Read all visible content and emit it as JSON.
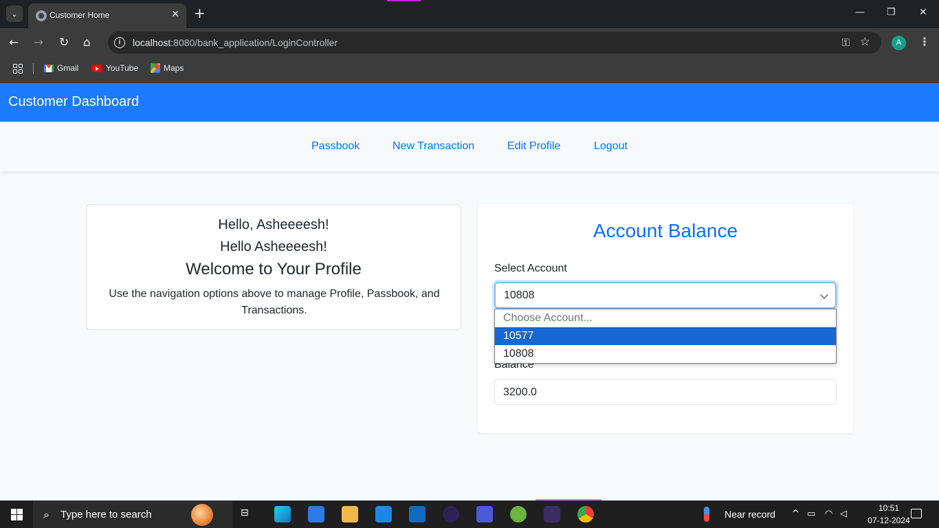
{
  "browser": {
    "tab_title": "Customer Home",
    "url_host": "localhost",
    "url_rest": ":8080/bank_application/LoginController",
    "profile_initial": "A",
    "bookmarks": [
      {
        "label": "Gmail",
        "icon": "gmail-icon"
      },
      {
        "label": "YouTube",
        "icon": "youtube-icon"
      },
      {
        "label": "Maps",
        "icon": "maps-icon"
      }
    ]
  },
  "header": {
    "title": "Customer Dashboard",
    "color": "#1a7bff"
  },
  "nav": {
    "items": [
      "Passbook",
      "New Transaction",
      "Edit Profile",
      "Logout"
    ],
    "link_color": "#0d6efd"
  },
  "profile_card": {
    "greeting1": "Hello, Asheeeesh!",
    "greeting2": "Hello Asheeeesh!",
    "heading": "Welcome to Your Profile",
    "description": "Use the navigation options above to manage Profile, Passbook, and Transactions."
  },
  "balance_card": {
    "title": "Account Balance",
    "select_label": "Select Account",
    "selected_value": "10808",
    "options": [
      "Choose Account...",
      "10577",
      "10808"
    ],
    "highlighted_option": "10577",
    "balance_label": "Balance",
    "balance_value": "3200.0"
  },
  "taskbar": {
    "search_placeholder": "Type here to search",
    "weather": "Near record",
    "time": "10:51",
    "date": "07-12-2024"
  }
}
